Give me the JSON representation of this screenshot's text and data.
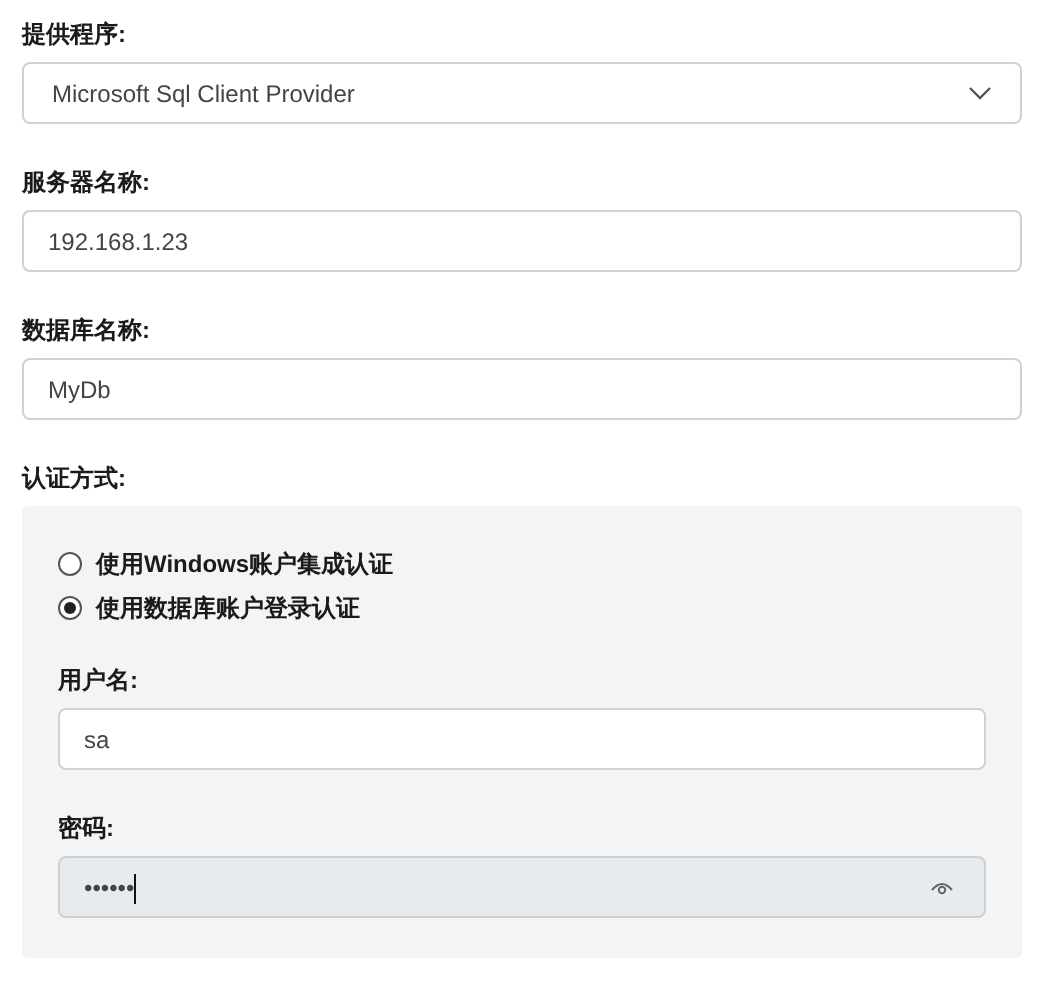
{
  "provider": {
    "label": "提供程序:",
    "value": "Microsoft Sql Client Provider"
  },
  "server": {
    "label": "服务器名称:",
    "value": "192.168.1.23"
  },
  "database": {
    "label": "数据库名称:",
    "value": "MyDb"
  },
  "auth": {
    "label": "认证方式:",
    "options": [
      {
        "label": "使用Windows账户集成认证",
        "selected": false
      },
      {
        "label": "使用数据库账户登录认证",
        "selected": true
      }
    ],
    "username": {
      "label": "用户名:",
      "value": "sa"
    },
    "password": {
      "label": "密码:",
      "value": "••••••",
      "focused": true
    }
  }
}
